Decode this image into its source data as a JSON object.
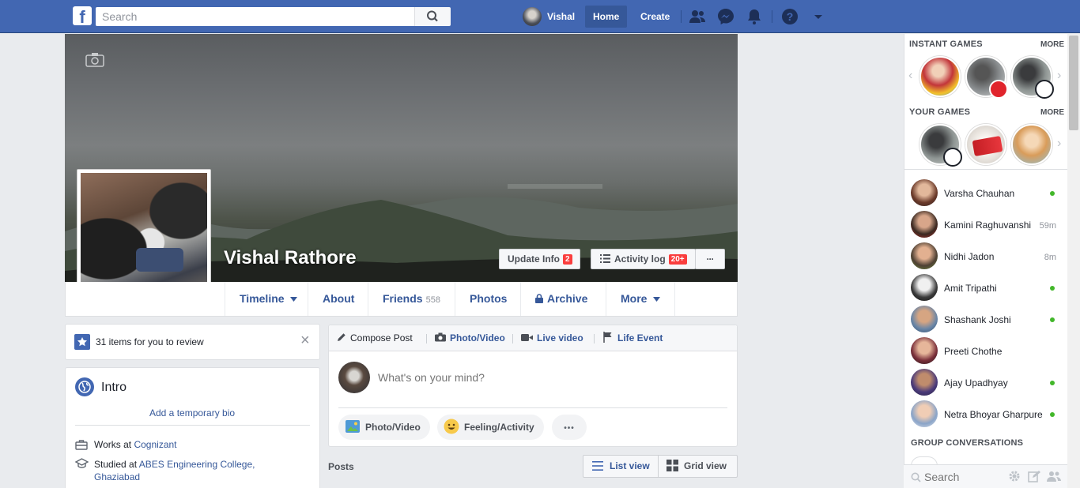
{
  "topbar": {
    "logo": "f",
    "search_placeholder": "Search",
    "user_name": "Vishal",
    "home": "Home",
    "create": "Create"
  },
  "profile": {
    "name": "Vishal Rathore",
    "update_info": "Update Info",
    "update_info_badge": "2",
    "activity_log": "Activity log",
    "activity_log_badge": "20+",
    "more_dots": "···"
  },
  "tabs": {
    "timeline": "Timeline",
    "about": "About",
    "friends": "Friends",
    "friends_count": "558",
    "photos": "Photos",
    "archive": "Archive",
    "more": "More"
  },
  "review": {
    "text": "31 items for you to review",
    "close": "×"
  },
  "intro": {
    "title": "Intro",
    "add_bio": "Add a temporary bio",
    "works_prefix": "Works at ",
    "works_at": "Cognizant",
    "studied_prefix": "Studied at ",
    "studied_at": "ABES Engineering College,",
    "studied_city": "Ghaziabad"
  },
  "composer": {
    "compose_post": "Compose Post",
    "photo_video": "Photo/Video",
    "live_video": "Live video",
    "life_event": "Life Event",
    "placeholder": "What's on your mind?",
    "pill_photo": "Photo/Video",
    "pill_feeling": "Feeling/Activity",
    "pill_more": "•••"
  },
  "posts": {
    "label": "Posts",
    "list_view": "List view",
    "grid_view": "Grid view"
  },
  "sidebar": {
    "instant_games": "INSTANT GAMES",
    "your_games": "YOUR GAMES",
    "more": "MORE",
    "group_conversations": "GROUP CONVERSATIONS",
    "search_placeholder": "Search",
    "contacts": [
      {
        "name": "Varsha Chauhan",
        "status": "online",
        "time": ""
      },
      {
        "name": "Kamini Raghuvanshi",
        "status": "away",
        "time": "59m"
      },
      {
        "name": "Nidhi Jadon",
        "status": "away",
        "time": "8m"
      },
      {
        "name": "Amit Tripathi",
        "status": "online",
        "time": ""
      },
      {
        "name": "Shashank Joshi",
        "status": "online",
        "time": ""
      },
      {
        "name": "Preeti Chothe",
        "status": "offline",
        "time": ""
      },
      {
        "name": "Ajay Upadhyay",
        "status": "online",
        "time": ""
      },
      {
        "name": "Netra Bhoyar Gharpure",
        "status": "online",
        "time": ""
      }
    ]
  },
  "colors": {
    "brand": "#4267b2",
    "link": "#365899",
    "online": "#42b72a",
    "badge": "#fa3e3e"
  }
}
